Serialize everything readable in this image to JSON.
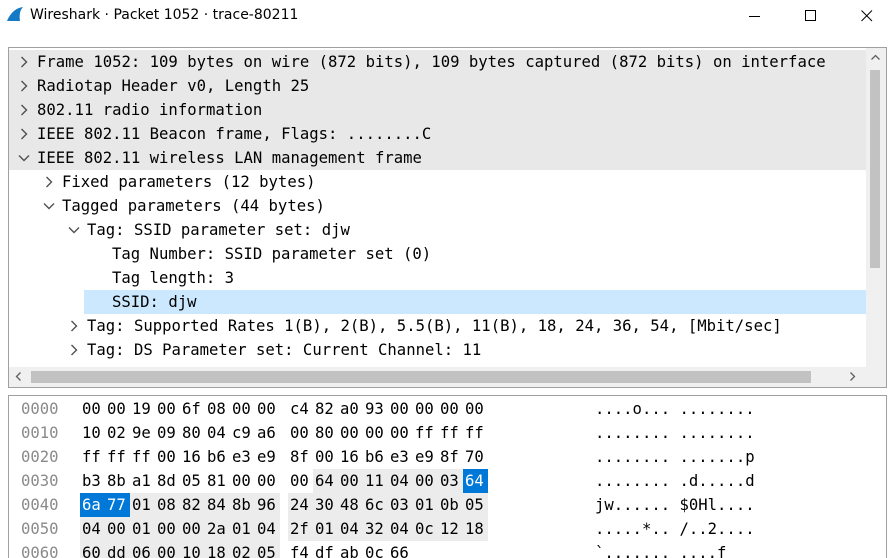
{
  "window": {
    "title": "Wireshark · Packet 1052 · trace-80211",
    "controls": [
      "minimize-icon",
      "maximize-icon",
      "close-icon"
    ]
  },
  "tree": {
    "rows": [
      {
        "text": "Frame 1052: 109 bytes on wire (872 bits), 109 bytes captured (872 bits) on interface",
        "expander": "collapsed",
        "indent": 0
      },
      {
        "text": "Radiotap Header v0, Length 25",
        "expander": "collapsed",
        "indent": 0
      },
      {
        "text": "802.11 radio information",
        "expander": "collapsed",
        "indent": 0
      },
      {
        "text": "IEEE 802.11 Beacon frame, Flags: ........C",
        "expander": "collapsed",
        "indent": 0
      },
      {
        "text": "IEEE 802.11 wireless LAN management frame",
        "expander": "expanded",
        "indent": 0
      },
      {
        "text": "Fixed parameters (12 bytes)",
        "expander": "collapsed",
        "indent": 1
      },
      {
        "text": "Tagged parameters (44 bytes)",
        "expander": "expanded",
        "indent": 1
      },
      {
        "text": "Tag: SSID parameter set: djw",
        "expander": "expanded",
        "indent": 2
      },
      {
        "text": "Tag Number: SSID parameter set (0)",
        "expander": "none",
        "indent": 3
      },
      {
        "text": "Tag length: 3",
        "expander": "none",
        "indent": 3
      },
      {
        "text": "SSID: djw",
        "expander": "none",
        "indent": 3,
        "selected": true
      },
      {
        "text": "Tag: Supported Rates 1(B), 2(B), 5.5(B), 11(B), 18, 24, 36, 54, [Mbit/sec]",
        "expander": "collapsed",
        "indent": 2
      },
      {
        "text": "Tag: DS Parameter set: Current Channel: 11",
        "expander": "collapsed",
        "indent": 2
      }
    ]
  },
  "bytes": {
    "rows": [
      {
        "offset": "0000",
        "hex": [
          "00",
          "00",
          "19",
          "00",
          "6f",
          "08",
          "00",
          "00",
          "c4",
          "82",
          "a0",
          "93",
          "00",
          "00",
          "00",
          "00"
        ],
        "ascii": "....o... ........"
      },
      {
        "offset": "0010",
        "hex": [
          "10",
          "02",
          "9e",
          "09",
          "80",
          "04",
          "c9",
          "a6",
          "00",
          "80",
          "00",
          "00",
          "00",
          "ff",
          "ff",
          "ff"
        ],
        "ascii": "........ ........"
      },
      {
        "offset": "0020",
        "hex": [
          "ff",
          "ff",
          "ff",
          "00",
          "16",
          "b6",
          "e3",
          "e9",
          "8f",
          "00",
          "16",
          "b6",
          "e3",
          "e9",
          "8f",
          "70"
        ],
        "ascii": "........ .......p"
      },
      {
        "offset": "0030",
        "hex": [
          "b3",
          "8b",
          "a1",
          "8d",
          "05",
          "81",
          "00",
          "00",
          "00",
          "64",
          "00",
          "11",
          "04",
          "00",
          "03",
          "64"
        ],
        "ascii": "........ .d.....d"
      },
      {
        "offset": "0040",
        "hex": [
          "6a",
          "77",
          "01",
          "08",
          "82",
          "84",
          "8b",
          "96",
          "24",
          "30",
          "48",
          "6c",
          "03",
          "01",
          "0b",
          "05"
        ],
        "ascii": "jw...... $0Hl...."
      },
      {
        "offset": "0050",
        "hex": [
          "04",
          "00",
          "01",
          "00",
          "00",
          "2a",
          "01",
          "04",
          "2f",
          "01",
          "04",
          "32",
          "04",
          "0c",
          "12",
          "18"
        ],
        "ascii": ".....*.. /..2...."
      },
      {
        "offset": "0060",
        "hex": [
          "60",
          "dd",
          "06",
          "00",
          "10",
          "18",
          "02",
          "05",
          "f4",
          "df",
          "ab",
          "0c",
          "66"
        ],
        "ascii": "`....... ....f"
      }
    ],
    "highlight": [
      {
        "row": 3,
        "cells": [
          15
        ]
      },
      {
        "row": 4,
        "cells": [
          0,
          1
        ]
      }
    ],
    "colors": {
      "selection": "#0078d7",
      "field_bg": "#ececec",
      "tree_selected": "#cce8ff",
      "tree_shaded": "#e8e8e8"
    }
  }
}
